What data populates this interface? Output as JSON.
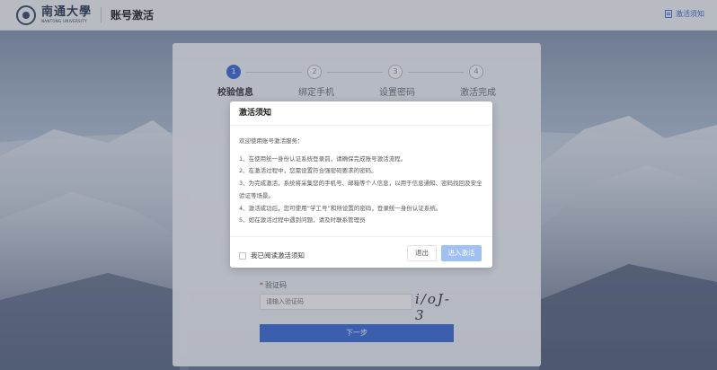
{
  "header": {
    "logo_cn": "南通大學",
    "logo_en": "NANTONG UNIVERSITY",
    "page_title": "账号激活",
    "notice_link": "激活须知"
  },
  "steps": [
    {
      "num": "1",
      "label": "校验信息",
      "active": true
    },
    {
      "num": "2",
      "label": "绑定手机",
      "active": false
    },
    {
      "num": "3",
      "label": "设置密码",
      "active": false
    },
    {
      "num": "4",
      "label": "激活完成",
      "active": false
    }
  ],
  "form": {
    "code_label": "验证码",
    "code_placeholder": "请输入验证码",
    "captcha_text": "i/oJ-3",
    "next_label": "下一步"
  },
  "modal": {
    "title": "激活须知",
    "intro": "欢迎使用账号激活服务：",
    "items": [
      "1、在使用统一身份认证系统登录前，请确保完成账号激活流程。",
      "2、在激活过程中，您需设置符合强密码要求的密码。",
      "3、为完成激活，系统将采集您的手机号、邮箱等个人信息，以用于信息通知、密码找回及安全验证等场景。",
      "4、激活成功后，您可使用“学工号”和所设置的密码，登录统一身份认证系统。",
      "5、如在激活过程中遇到问题，请及时联系管理员"
    ],
    "checkbox_label": "我已阅读激活须知",
    "exit_label": "退出",
    "enter_label": "进入激活"
  },
  "colors": {
    "accent": "#3b6dd8",
    "disabled_button": "#9fc0f2"
  }
}
